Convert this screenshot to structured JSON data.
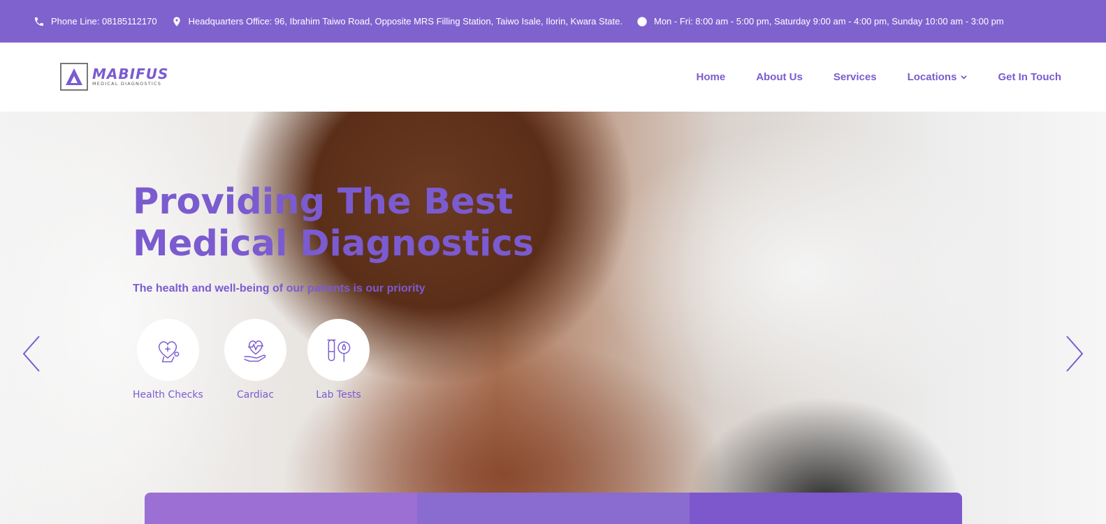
{
  "topbar": {
    "phone": "Phone Line: 08185112170",
    "address": "Headquarters Office: 96, Ibrahim Taiwo Road, Opposite MRS Filling Station, Taiwo Isale, Ilorin, Kwara State.",
    "hours": "Mon - Fri: 8:00 am - 5:00 pm, Saturday 9:00 am - 4:00 pm, Sunday 10:00 am - 3:00 pm",
    "icons": [
      "phone-icon",
      "location-pin-icon",
      "clock-icon"
    ]
  },
  "logo": {
    "name": "MABIFUS",
    "tagline": "MEDICAL DIAGNOSTICS"
  },
  "nav": {
    "items": [
      {
        "label": "Home"
      },
      {
        "label": "About Us"
      },
      {
        "label": "Services"
      },
      {
        "label": "Locations",
        "has_dropdown": true
      },
      {
        "label": "Get In Touch"
      }
    ]
  },
  "hero": {
    "title_line1": "Providing The Best",
    "title_line2": "Medical Diagnostics",
    "subtitle": "The health and well-being of our patients is our priority",
    "services": [
      {
        "label": "Health Checks",
        "icon": "heart-stethoscope-icon"
      },
      {
        "label": "Cardiac",
        "icon": "hand-heartbeat-icon"
      },
      {
        "label": "Lab Tests",
        "icon": "test-tube-blood-icon"
      }
    ]
  },
  "colors": {
    "primary": "#8062cf",
    "accent_text": "#7b5bd0",
    "strip_1": "#9b6fd3",
    "strip_2": "#8a6bcf",
    "strip_3": "#7d57cc"
  }
}
